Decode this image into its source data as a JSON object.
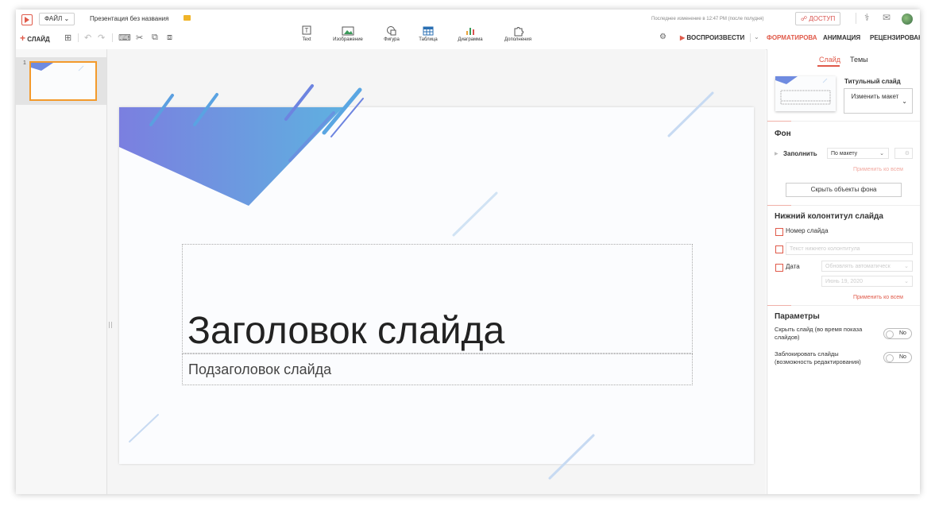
{
  "header": {
    "file_button": "ФАЙЛ",
    "doc_title": "Презентация без названия",
    "last_change": "Последнее изменение в 12:47 PM (после полудня)",
    "access_button": "ДОСТУП"
  },
  "toolbar": {
    "add_slide": "СЛАЙД",
    "insert": [
      {
        "label": "Text",
        "icon": "text-icon"
      },
      {
        "label": "Изображение",
        "icon": "image-icon"
      },
      {
        "label": "Фигура",
        "icon": "shape-icon"
      },
      {
        "label": "Таблица",
        "icon": "table-icon"
      },
      {
        "label": "Диаграмма",
        "icon": "chart-icon"
      },
      {
        "label": "Дополнения",
        "icon": "puzzle-icon"
      }
    ],
    "play": "ВОСПРОИЗВЕСТИ",
    "tabs": [
      "ФОРМАТИРОВА",
      "АНИМАЦИЯ",
      "РЕЦЕНЗИРОВАН"
    ]
  },
  "slides_panel": {
    "slide_number": "1"
  },
  "slide": {
    "title": "Заголовок слайда",
    "subtitle": "Подзаголовок слайда"
  },
  "format_panel": {
    "tabs": [
      "Слайд",
      "Темы"
    ],
    "layout_name": "Титульный слайд",
    "change_layout": "Изменить макет",
    "background": {
      "heading": "Фон",
      "fill_label": "Заполнить",
      "fill_value": "По макету",
      "apply_all": "Применить ко всем",
      "hide_bg_button": "Скрыть объекты фона"
    },
    "footer": {
      "heading": "Нижний колонтитул слайда",
      "slide_number": "Номер слайда",
      "footer_text_placeholder": "Текст нижнего колонтитула",
      "date": "Дата",
      "date_mode": "Обновлять автоматическ",
      "date_value": "Июнь 19, 2020",
      "apply_all": "Применить ко всем"
    },
    "params": {
      "heading": "Параметры",
      "hide_slide": "Скрыть слайд (во время показа слайдов)",
      "hide_slide_toggle": "No",
      "lock_slides": "Заблокировать слайды (возможность редактирования)",
      "lock_slides_toggle": "No"
    }
  },
  "colors": {
    "accent": "#e05a4a",
    "selection": "#f39a2b",
    "deco_start": "#7b7fe0",
    "deco_end": "#5fb0e0"
  }
}
